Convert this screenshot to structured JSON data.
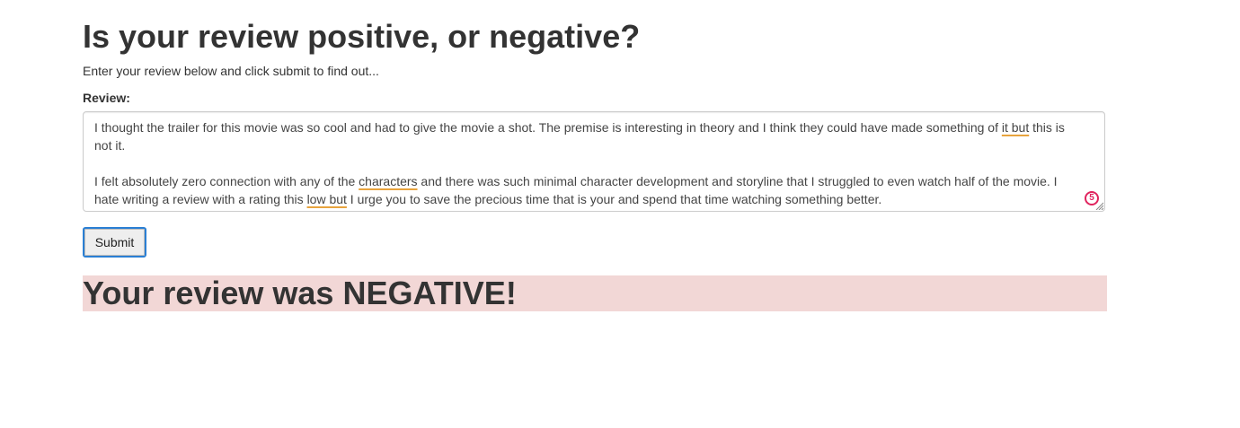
{
  "header": {
    "title": "Is your review positive, or negative?",
    "subtitle": "Enter your review below and click submit to find out..."
  },
  "form": {
    "review_label": "Review:",
    "review_text": {
      "p1_a": "I thought the trailer for this movie was so cool and had to give the movie a shot. The premise is interesting in theory and I think they could have made something of ",
      "p1_flag": "it but",
      "p1_b": " this is not it.",
      "p2_a": "I felt absolutely zero connection with any of the ",
      "p2_flag1": "characters",
      "p2_b": " and there was such minimal character development and storyline that I struggled to even watch half of the movie. I hate writing a review with a rating this ",
      "p2_flag2": "low but",
      "p2_c": " I urge you to save the precious time that is your and spend that time watching something better."
    },
    "grammar_count": "5",
    "submit_label": "Submit"
  },
  "result": {
    "text": "Your review was NEGATIVE!",
    "sentiment": "negative",
    "banner_color": "#f2d7d6"
  },
  "colors": {
    "focus_border": "#2a7fd4",
    "spell_underline": "#e8a33d",
    "grammar_badge": "#e0245e"
  }
}
